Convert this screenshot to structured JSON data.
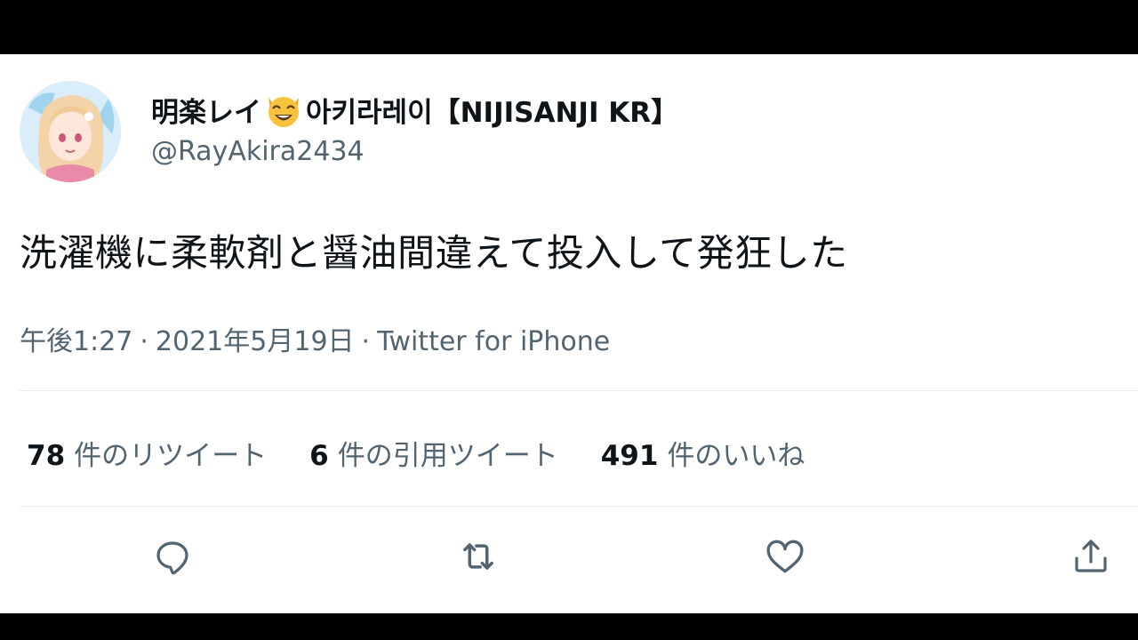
{
  "tweet": {
    "author": {
      "display_name_jp": "明楽レイ",
      "display_name_kr": "아키라레이",
      "display_name_tag": "【NIJISANJI KR】",
      "emoji": "smiling-cat-emoji",
      "handle": "@RayAkira2434"
    },
    "text": "洗濯機に柔軟剤と醤油間違えて投入して発狂した",
    "meta": {
      "time": "午後1:27",
      "separator": "·",
      "date": "2021年5月19日",
      "source": "Twitter for iPhone"
    },
    "stats": {
      "retweets": {
        "count": "78",
        "label": "件のリツイート"
      },
      "quotes": {
        "count": "6",
        "label": "件の引用ツイート"
      },
      "likes": {
        "count": "491",
        "label": "件のいいね"
      }
    },
    "actions": {
      "reply_icon": "reply-icon",
      "retweet_icon": "retweet-icon",
      "like_icon": "heart-icon",
      "share_icon": "share-icon"
    }
  },
  "colors": {
    "text_primary": "#0f1419",
    "text_secondary": "#536471",
    "divider": "#e6ecf0",
    "background": "#ffffff",
    "letterbox": "#000000"
  }
}
